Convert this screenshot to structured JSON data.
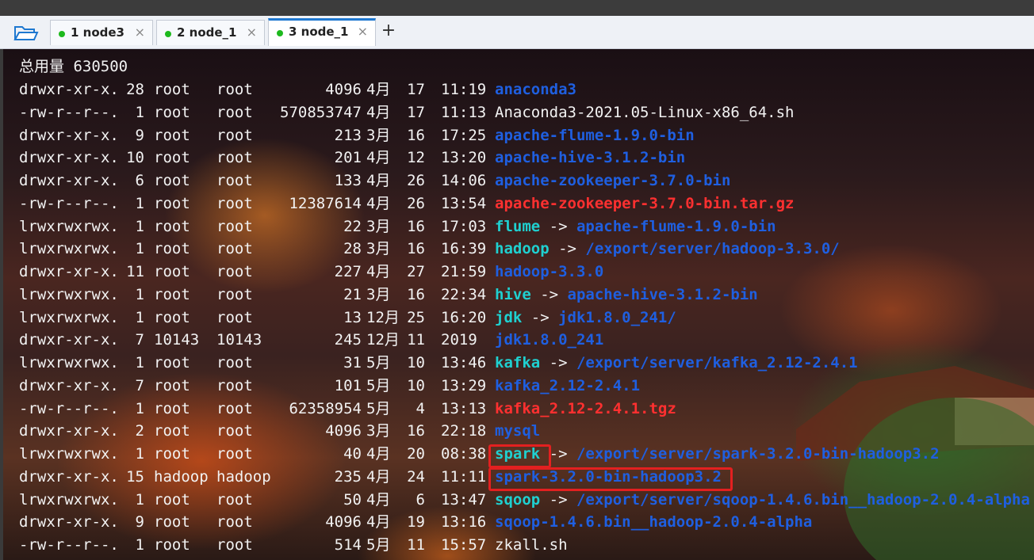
{
  "tabs": [
    {
      "label": "1 node3",
      "active": false
    },
    {
      "label": "2 node_1",
      "active": false
    },
    {
      "label": "3 node_1",
      "active": true
    }
  ],
  "add_tab_label": "+",
  "close_glyph": "×",
  "terminal": {
    "total_line": "总用量 630500",
    "entries": [
      {
        "perms": "drwxr-xr-x.",
        "links": "28",
        "user": "root",
        "group": "root",
        "size": "4096",
        "month": "4月",
        "day": "17",
        "time": "11:19",
        "name": "anaconda3",
        "target": "",
        "name_color": "blue",
        "target_color": ""
      },
      {
        "perms": "-rw-r--r--.",
        "links": "1",
        "user": "root",
        "group": "root",
        "size": "570853747",
        "month": "4月",
        "day": "17",
        "time": "11:13",
        "name": "Anaconda3-2021.05-Linux-x86_64.sh",
        "target": "",
        "name_color": "white",
        "target_color": ""
      },
      {
        "perms": "drwxr-xr-x.",
        "links": "9",
        "user": "root",
        "group": "root",
        "size": "213",
        "month": "3月",
        "day": "16",
        "time": "17:25",
        "name": "apache-flume-1.9.0-bin",
        "target": "",
        "name_color": "blue",
        "target_color": ""
      },
      {
        "perms": "drwxr-xr-x.",
        "links": "10",
        "user": "root",
        "group": "root",
        "size": "201",
        "month": "4月",
        "day": "12",
        "time": "13:20",
        "name": "apache-hive-3.1.2-bin",
        "target": "",
        "name_color": "blue",
        "target_color": ""
      },
      {
        "perms": "drwxr-xr-x.",
        "links": "6",
        "user": "root",
        "group": "root",
        "size": "133",
        "month": "4月",
        "day": "26",
        "time": "14:06",
        "name": "apache-zookeeper-3.7.0-bin",
        "target": "",
        "name_color": "blue",
        "target_color": ""
      },
      {
        "perms": "-rw-r--r--.",
        "links": "1",
        "user": "root",
        "group": "root",
        "size": "12387614",
        "month": "4月",
        "day": "26",
        "time": "13:54",
        "name": "apache-zookeeper-3.7.0-bin.tar.gz",
        "target": "",
        "name_color": "red",
        "target_color": ""
      },
      {
        "perms": "lrwxrwxrwx.",
        "links": "1",
        "user": "root",
        "group": "root",
        "size": "22",
        "month": "3月",
        "day": "16",
        "time": "17:03",
        "name": "flume",
        "target": "apache-flume-1.9.0-bin",
        "name_color": "cyan",
        "target_color": "blue"
      },
      {
        "perms": "lrwxrwxrwx.",
        "links": "1",
        "user": "root",
        "group": "root",
        "size": "28",
        "month": "3月",
        "day": "16",
        "time": "16:39",
        "name": "hadoop",
        "target": "/export/server/hadoop-3.3.0/",
        "name_color": "cyan",
        "target_color": "blue"
      },
      {
        "perms": "drwxr-xr-x.",
        "links": "11",
        "user": "root",
        "group": "root",
        "size": "227",
        "month": "4月",
        "day": "27",
        "time": "21:59",
        "name": "hadoop-3.3.0",
        "target": "",
        "name_color": "blue",
        "target_color": ""
      },
      {
        "perms": "lrwxrwxrwx.",
        "links": "1",
        "user": "root",
        "group": "root",
        "size": "21",
        "month": "3月",
        "day": "16",
        "time": "22:34",
        "name": "hive",
        "target": "apache-hive-3.1.2-bin",
        "name_color": "cyan",
        "target_color": "blue"
      },
      {
        "perms": "lrwxrwxrwx.",
        "links": "1",
        "user": "root",
        "group": "root",
        "size": "13",
        "month": "12月",
        "day": "25",
        "time": "16:20",
        "name": "jdk",
        "target": "jdk1.8.0_241/",
        "name_color": "cyan",
        "target_color": "blue"
      },
      {
        "perms": "drwxr-xr-x.",
        "links": "7",
        "user": "10143",
        "group": "10143",
        "size": "245",
        "month": "12月",
        "day": "11",
        "time": "2019",
        "name": "jdk1.8.0_241",
        "target": "",
        "name_color": "blue",
        "target_color": ""
      },
      {
        "perms": "lrwxrwxrwx.",
        "links": "1",
        "user": "root",
        "group": "root",
        "size": "31",
        "month": "5月",
        "day": "10",
        "time": "13:46",
        "name": "kafka",
        "target": "/export/server/kafka_2.12-2.4.1",
        "name_color": "cyan",
        "target_color": "blue"
      },
      {
        "perms": "drwxr-xr-x.",
        "links": "7",
        "user": "root",
        "group": "root",
        "size": "101",
        "month": "5月",
        "day": "10",
        "time": "13:29",
        "name": "kafka_2.12-2.4.1",
        "target": "",
        "name_color": "blue",
        "target_color": ""
      },
      {
        "perms": "-rw-r--r--.",
        "links": "1",
        "user": "root",
        "group": "root",
        "size": "62358954",
        "month": "5月",
        "day": "4",
        "time": "13:13",
        "name": "kafka_2.12-2.4.1.tgz",
        "target": "",
        "name_color": "red",
        "target_color": ""
      },
      {
        "perms": "drwxr-xr-x.",
        "links": "2",
        "user": "root",
        "group": "root",
        "size": "4096",
        "month": "3月",
        "day": "16",
        "time": "22:18",
        "name": "mysql",
        "target": "",
        "name_color": "blue",
        "target_color": ""
      },
      {
        "perms": "lrwxrwxrwx.",
        "links": "1",
        "user": "root",
        "group": "root",
        "size": "40",
        "month": "4月",
        "day": "20",
        "time": "08:38",
        "name": "spark",
        "target": "/export/server/spark-3.2.0-bin-hadoop3.2",
        "name_color": "cyan",
        "target_color": "blue"
      },
      {
        "perms": "drwxr-xr-x.",
        "links": "15",
        "user": "hadoop",
        "group": "hadoop",
        "size": "235",
        "month": "4月",
        "day": "24",
        "time": "11:11",
        "name": "spark-3.2.0-bin-hadoop3.2",
        "target": "",
        "name_color": "blue",
        "target_color": ""
      },
      {
        "perms": "lrwxrwxrwx.",
        "links": "1",
        "user": "root",
        "group": "root",
        "size": "50",
        "month": "4月",
        "day": "6",
        "time": "13:47",
        "name": "sqoop",
        "target": "/export/server/sqoop-1.4.6.bin__hadoop-2.0.4-alpha",
        "name_color": "cyan",
        "target_color": "blue"
      },
      {
        "perms": "drwxr-xr-x.",
        "links": "9",
        "user": "root",
        "group": "root",
        "size": "4096",
        "month": "4月",
        "day": "19",
        "time": "13:16",
        "name": "sqoop-1.4.6.bin__hadoop-2.0.4-alpha",
        "target": "",
        "name_color": "blue",
        "target_color": ""
      },
      {
        "perms": "-rw-r--r--.",
        "links": "1",
        "user": "root",
        "group": "root",
        "size": "514",
        "month": "5月",
        "day": "11",
        "time": "15:57",
        "name": "zkall.sh",
        "target": "",
        "name_color": "white",
        "target_color": ""
      }
    ],
    "arrow": "->",
    "highlight_color": "#e32020"
  }
}
